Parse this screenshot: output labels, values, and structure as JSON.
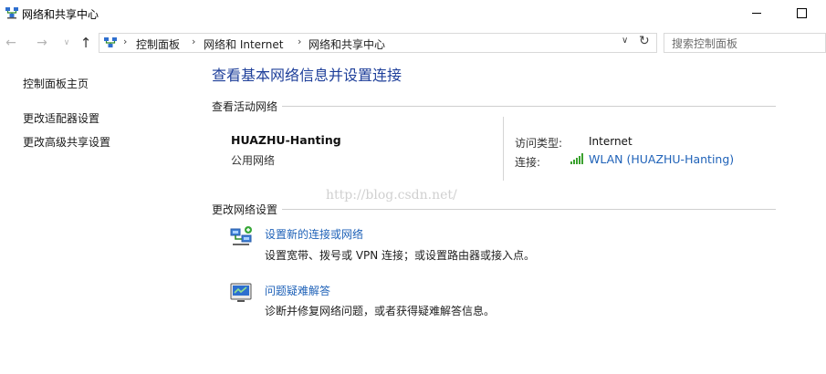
{
  "window": {
    "title": "网络和共享中心"
  },
  "nav": {
    "breadcrumbs": [
      "控制面板",
      "网络和 Internet",
      "网络和共享中心"
    ],
    "search_placeholder": "搜索控制面板"
  },
  "left_pane": {
    "links": [
      "控制面板主页",
      "更改适配器设置",
      "更改高级共享设置"
    ]
  },
  "main": {
    "title": "查看基本网络信息并设置连接",
    "active_networks_label": "查看活动网络",
    "network": {
      "name": "HUAZHU-Hanting",
      "category": "公用网络",
      "access_type_label": "访问类型:",
      "access_type_value": "Internet",
      "connections_label": "连接:",
      "connection_link": "WLAN (HUAZHU-Hanting)"
    },
    "watermark": "http://blog.csdn.net/",
    "change_settings_label": "更改网络设置",
    "tasks": [
      {
        "icon": "network-setup-icon",
        "link": "设置新的连接或网络",
        "description": "设置宽带、拨号或 VPN 连接；或设置路由器或接入点。"
      },
      {
        "icon": "troubleshoot-icon",
        "link": "问题疑难解答",
        "description": "诊断并修复网络问题，或者获得疑难解答信息。"
      }
    ]
  },
  "colors": {
    "heading": "#1e3f9a",
    "link": "#1f62b8",
    "signal_bars": "#3aa12e"
  }
}
